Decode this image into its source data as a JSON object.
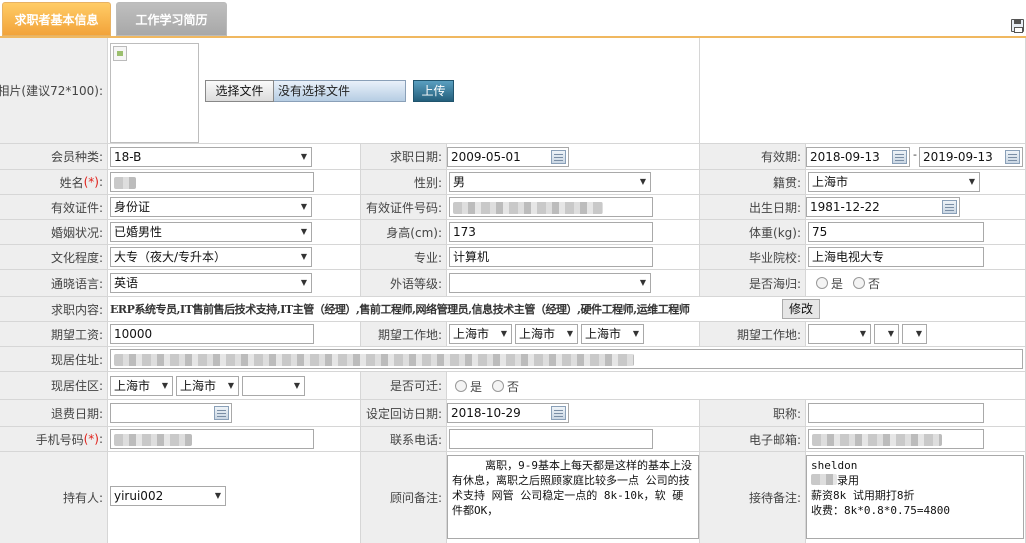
{
  "tabs": [
    {
      "label": "求职者基本信息",
      "active": true
    },
    {
      "label": "工作学习简历",
      "active": false
    }
  ],
  "photo": {
    "label": "相片(建议72*100):",
    "choose_file_label": "选择文件",
    "no_file_text": "没有选择文件",
    "upload_label": "上传"
  },
  "labels": {
    "member_type": "会员种类:",
    "apply_date": "求职日期:",
    "valid_period": "有效期:",
    "name": "姓名",
    "gender": "性别:",
    "native_place": "籍贯:",
    "id_type": "有效证件:",
    "id_number": "有效证件号码:",
    "birth_date": "出生日期:",
    "marital": "婚姻状况:",
    "height": "身高(cm):",
    "weight": "体重(kg):",
    "education": "文化程度:",
    "major": "专业:",
    "school": "毕业院校:",
    "language": "通晓语言:",
    "foreign_level": "外语等级:",
    "returnee": "是否海归:",
    "job_content": "求职内容:",
    "expected_salary": "期望工资:",
    "expected_location1": "期望工作地:",
    "expected_location2": "期望工作地:",
    "current_address": "现居住址:",
    "current_district": "现居住区:",
    "relocate": "是否可迁:",
    "refund_date": "退费日期:",
    "callback_date": "设定回访日期:",
    "job_title": "职称:",
    "mobile": "手机号码",
    "phone": "联系电话:",
    "email": "电子邮箱:",
    "holder": "持有人:",
    "consultant_note": "顾问备注:",
    "reception_note": "接待备注:",
    "required_mark": "(*)",
    "colon": ":"
  },
  "values": {
    "member_type": "18-B",
    "apply_date": "2009-05-01",
    "valid_from": "2018-09-13",
    "valid_sep": "-",
    "valid_to": "2019-09-13",
    "gender": "男",
    "native_place": "上海市",
    "id_type": "身份证",
    "birth_date": "1981-12-22",
    "marital": "已婚男性",
    "height": "173",
    "weight": "75",
    "education": "大专（夜大/专升本）",
    "major": "计算机",
    "school": "上海电视大专",
    "language": "英语",
    "foreign_level": "",
    "returnee_yes": "是",
    "returnee_no": "否",
    "job_content": "ERP系统专员,IT售前售后技术支持,IT主管（经理）,售前工程师,网络管理员,信息技术主管（经理）,硬件工程师,运维工程师",
    "modify_label": "修改",
    "expected_salary": "10000",
    "loc1_a": "上海市",
    "loc1_b": "上海市",
    "loc1_c": "上海市",
    "loc2_a": "",
    "loc2_b": "",
    "loc2_c": "",
    "district_a": "上海市",
    "district_b": "上海市",
    "district_c": "",
    "relocate_yes": "是",
    "relocate_no": "否",
    "refund_date": "",
    "callback_date": "2018-10-29",
    "job_title": "",
    "phone": "",
    "holder": "yirui002",
    "consultant_note": "     离职，9-9基本上每天都是这样的基本上没有休息，离职之后照顾家庭比较多一点 公司的技术支持 网管 公司稳定一点的 8k-10k，软 硬件都OK，",
    "reception_line1": "sheldon",
    "reception_line2": "录用",
    "reception_line3": "薪资8k 试用期打8折",
    "reception_line4": "收费：8k*0.8*0.75=4800"
  },
  "colors": {
    "active_tab": "#f2a33a",
    "inactive_tab": "#a8a8a8",
    "label_bg": "#eeeeee",
    "required": "#e0201a",
    "upload_button": "#2e6f8e"
  },
  "icons": [
    "save-icon",
    "calendar-icon",
    "dropdown-arrow-icon",
    "broken-image-icon"
  ]
}
